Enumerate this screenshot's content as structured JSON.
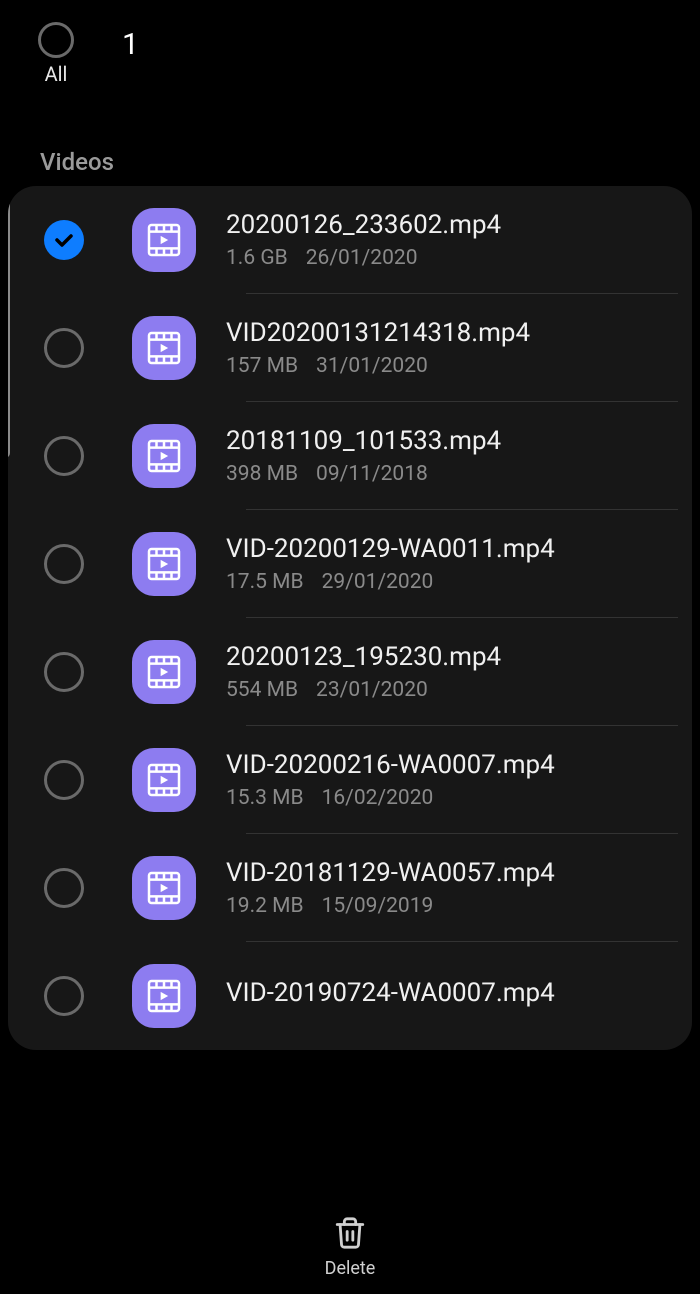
{
  "header": {
    "all_label": "All",
    "selected_count": "1"
  },
  "section_label": "Videos",
  "files": [
    {
      "name": "20200126_233602.mp4",
      "size": "1.6 GB",
      "date": "26/01/2020",
      "checked": true
    },
    {
      "name": "VID20200131214318.mp4",
      "size": "157 MB",
      "date": "31/01/2020",
      "checked": false
    },
    {
      "name": "20181109_101533.mp4",
      "size": "398 MB",
      "date": "09/11/2018",
      "checked": false
    },
    {
      "name": "VID-20200129-WA0011.mp4",
      "size": "17.5 MB",
      "date": "29/01/2020",
      "checked": false
    },
    {
      "name": "20200123_195230.mp4",
      "size": "554 MB",
      "date": "23/01/2020",
      "checked": false
    },
    {
      "name": "VID-20200216-WA0007.mp4",
      "size": "15.3 MB",
      "date": "16/02/2020",
      "checked": false
    },
    {
      "name": "VID-20181129-WA0057.mp4",
      "size": "19.2 MB",
      "date": "15/09/2019",
      "checked": false
    },
    {
      "name": "VID-20190724-WA0007.mp4",
      "size": "",
      "date": "",
      "checked": false
    }
  ],
  "bottom": {
    "delete_label": "Delete"
  }
}
